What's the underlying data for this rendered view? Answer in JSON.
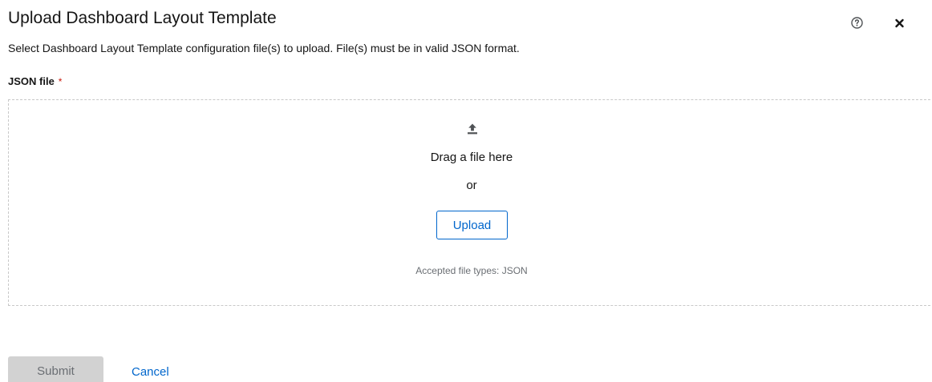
{
  "modal": {
    "title": "Upload Dashboard Layout Template",
    "description": "Select Dashboard Layout Template configuration file(s) to upload. File(s) must be in valid JSON format.",
    "help_icon": "help-circle-icon",
    "close_icon": "close-icon"
  },
  "field": {
    "label": "JSON file",
    "required_marker": "*"
  },
  "dropzone": {
    "icon": "upload-icon",
    "drag_text": "Drag a file here",
    "or_text": "or",
    "upload_label": "Upload",
    "accepted_types": "Accepted file types: JSON"
  },
  "footer": {
    "submit_label": "Submit",
    "cancel_label": "Cancel"
  },
  "colors": {
    "link": "#0066cc",
    "required": "#c9190b",
    "disabled_bg": "#d2d2d2",
    "muted_text": "#6a6e73"
  }
}
